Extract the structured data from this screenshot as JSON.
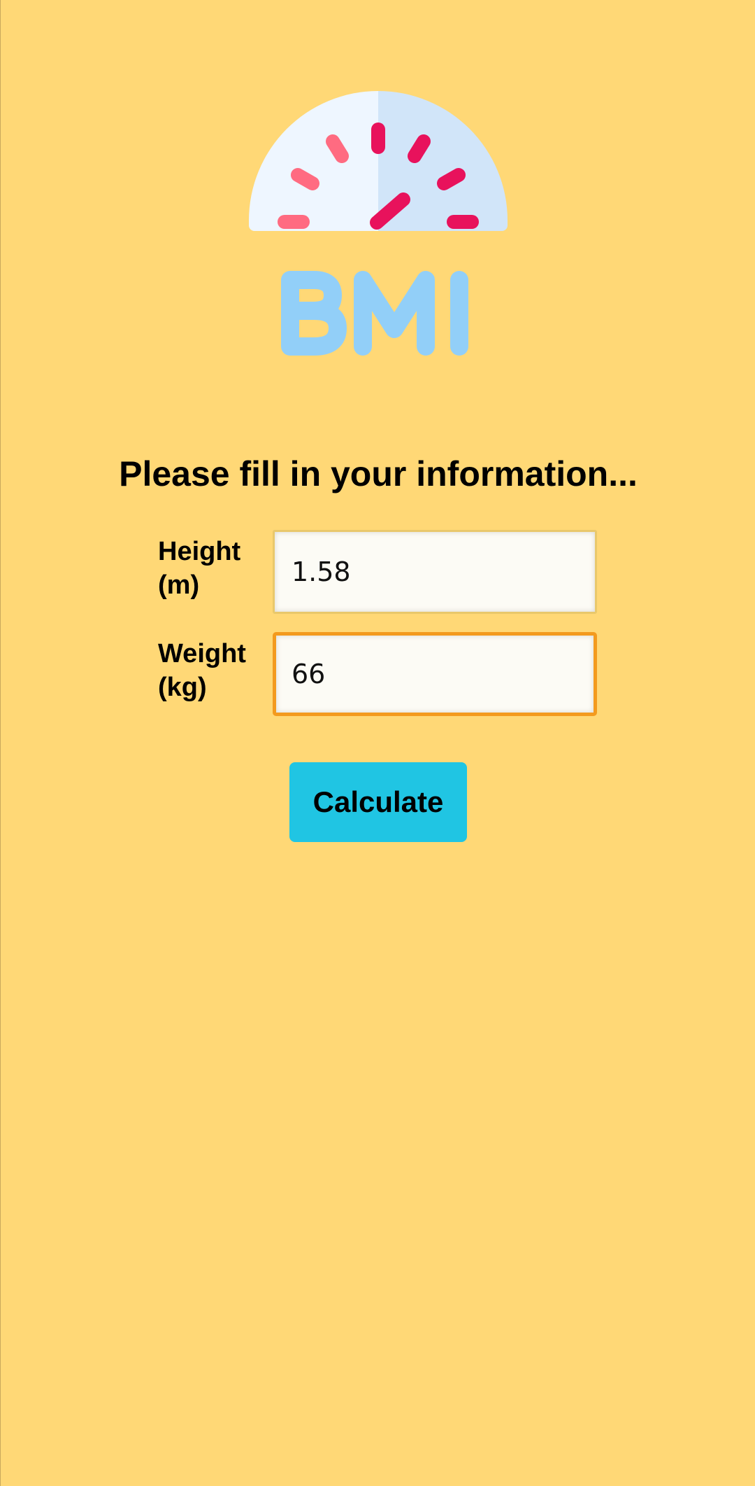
{
  "logo": {
    "text": "BMI",
    "icon": "speedometer-gauge-icon",
    "colors": {
      "dial_light": "#EEF6FF",
      "dial_shade": "#D1E5F9",
      "tick_light": "#FF6B81",
      "tick_dark": "#E8125C",
      "text": "#92CFF8"
    }
  },
  "title": "Please fill in your information...",
  "form": {
    "height_label": "Height (m)",
    "height_value": "1.58",
    "weight_label": "Weight (kg)",
    "weight_value": "66"
  },
  "calculate_button": "Calculate",
  "colors": {
    "background": "#FFD876",
    "button": "#20C5E3",
    "focus_border": "#F39A1E"
  }
}
